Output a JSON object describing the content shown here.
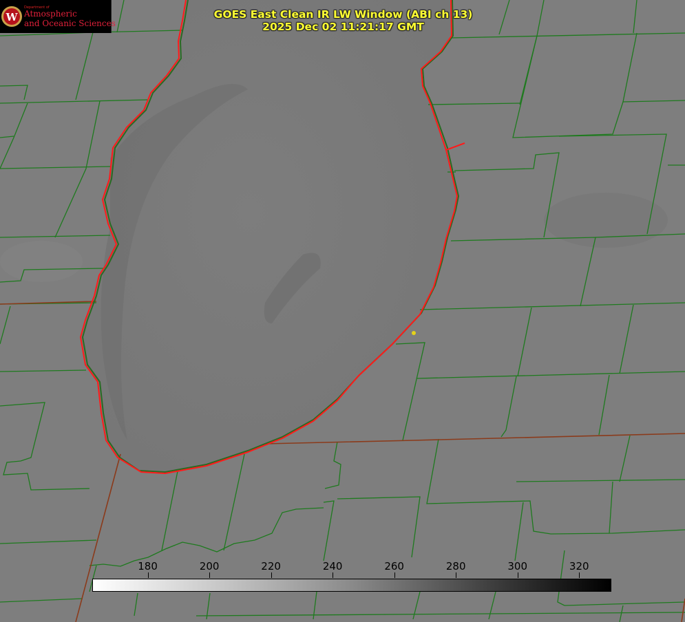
{
  "title": {
    "line1": "GOES East Clean IR LW Window (ABI ch 13)",
    "line2": "2025 Dec 02 11:21:17 GMT"
  },
  "logo": {
    "dept": "Department of",
    "line1": "Atmospheric",
    "line2": "and Oceanic Sciences",
    "emblem": "W"
  },
  "colorbar": {
    "ticks": [
      "180",
      "200",
      "220",
      "240",
      "260",
      "280",
      "300",
      "320"
    ],
    "tick_values": [
      180,
      200,
      220,
      240,
      260,
      280,
      300,
      320
    ],
    "range": [
      162,
      330
    ],
    "colormap": "white-to-black grayscale"
  },
  "colors": {
    "title_text": "#ffff33",
    "county_lines": "#1e7a1e",
    "state_lines": "#8b3a1a",
    "shoreline": "#ff1a1a",
    "marker": "#e5d21a"
  }
}
